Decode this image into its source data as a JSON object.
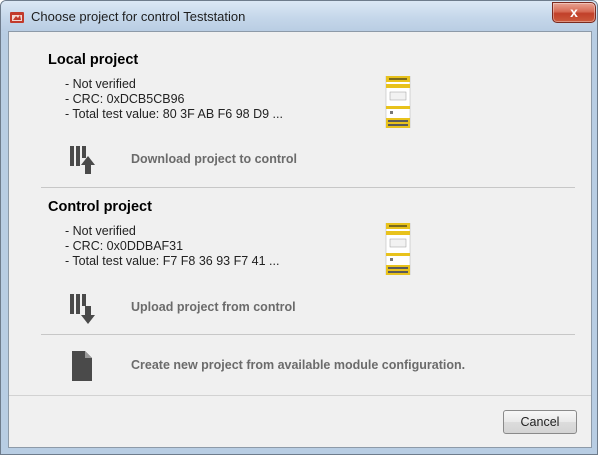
{
  "window": {
    "title": "Choose project for control Teststation",
    "close_label": "x"
  },
  "local_project": {
    "title": "Local project",
    "lines": [
      "- Not verified",
      "- CRC: 0xDCB5CB96",
      "- Total test value: 80 3F AB F6 98 D9 ..."
    ],
    "action_label": "Download project to control",
    "action_icon": "download-to-control-icon"
  },
  "control_project": {
    "title": "Control project",
    "lines": [
      "- Not verified",
      "- CRC: 0x0DDBAF31",
      "- Total test value: F7 F8 36 93 F7 41 ..."
    ],
    "action_label": "Upload project from control",
    "action_icon": "upload-from-control-icon"
  },
  "new_project": {
    "action_label": "Create new project from available module configuration.",
    "action_icon": "new-document-icon"
  },
  "footer": {
    "cancel_label": "Cancel"
  },
  "colors": {
    "device_yellow": "#e8c21c",
    "icon_dark": "#4a4a4a",
    "action_text": "#6b6b6b"
  }
}
